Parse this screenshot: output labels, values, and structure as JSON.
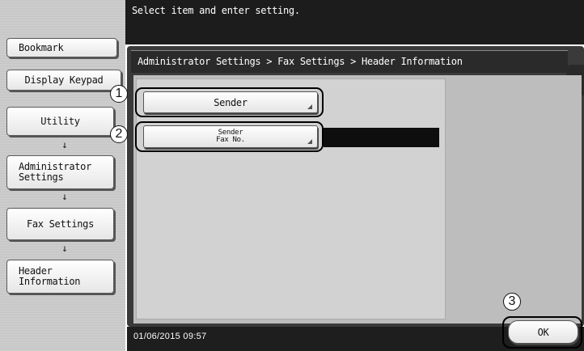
{
  "top_message": "Select item and enter setting.",
  "left_panel": {
    "bookmark": "Bookmark",
    "display_keypad": "Display Keypad",
    "flow": [
      "Utility",
      "Administrator Settings",
      "Fax Settings",
      "Header Information"
    ],
    "flow_arrow": "↓"
  },
  "breadcrumb": "Administrator Settings > Fax Settings > Header Information",
  "side_tab_icon": "back-arrow-icon",
  "side_tab_glyph": "↞",
  "buttons": {
    "sender": "Sender",
    "sender_fax_line1": "Sender",
    "sender_fax_line2": "Fax No.",
    "ok": "OK"
  },
  "callouts": [
    "1",
    "2",
    "3"
  ],
  "status": {
    "datetime": "01/06/2015  09:57"
  }
}
